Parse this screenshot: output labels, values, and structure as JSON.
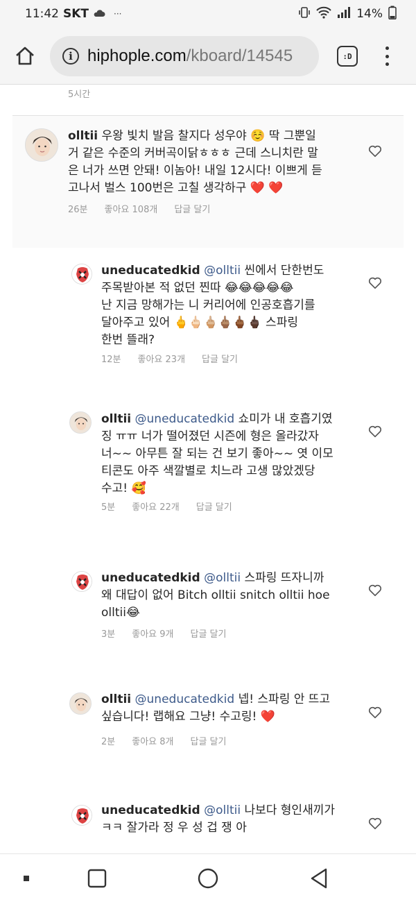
{
  "status_bar": {
    "time": "11:42",
    "carrier": "SKT",
    "extra": "···",
    "battery": "14%"
  },
  "browser": {
    "url_domain": "hiphople.com",
    "url_path": "/kboard/14545",
    "tab_label": ":D"
  },
  "thread": {
    "top_time": "5시간",
    "comments": [
      {
        "user": "olltii",
        "mention": "",
        "lines": [
          "우왕 빛치 발음 찰지다 성우야 ☺️ 딱 그뿐일",
          "거 같은 수준의 커버곡이닭ㅎㅎㅎ 근데 스니치란 말",
          "은 너가 쓰면 안돼! 이놈아! 내일 12시다! 이쁘게 듣",
          "고나서 벌스 100번은 고칠 생각하구 ❤️ ❤️"
        ],
        "time": "26분",
        "likes": "좋아요 108개",
        "reply": "답글 달기"
      },
      {
        "user": "uneducatedkid",
        "mention": "@olltii",
        "lines": [
          "씬에서 단한번도",
          "주목받아본 적 없던 찐따 😂😂😂😂😂",
          "난 지금 망해가는 니 커리어에 인공호흡기를",
          "달아주고 있어 🖕🖕🏻🖕🏼🖕🏽🖕🏾🖕🏿 스파링",
          "한번 뜰래?"
        ],
        "time": "12분",
        "likes": "좋아요 23개",
        "reply": "답글 달기"
      },
      {
        "user": "olltii",
        "mention": "@uneducatedkid",
        "lines": [
          "쇼미가 내 호흡기였",
          "징 ㅠㅠ 너가 떨어졌던 시즌에 형은 올라갔자",
          "너~~ 아무튼 잘 되는 건 보기 좋아~~ 엿 이모",
          "티콘도 아주 색깔별로 치느라 고생 많았겠당",
          "수고! 🥰"
        ],
        "time": "5분",
        "likes": "좋아요 22개",
        "reply": "답글 달기"
      },
      {
        "user": "uneducatedkid",
        "mention": "@olltii",
        "lines": [
          "스파링 뜨자니까",
          "왜 대답이 없어 Bitch olltii snitch olltii hoe",
          "olltii😂"
        ],
        "time": "3분",
        "likes": "좋아요 9개",
        "reply": "답글 달기"
      },
      {
        "user": "olltii",
        "mention": "@uneducatedkid",
        "lines": [
          "넵! 스파링 안 뜨고",
          "싶습니다! 랩해요 그냥! 수고링! ❤️"
        ],
        "time": "2분",
        "likes": "좋아요 8개",
        "reply": "답글 달기"
      },
      {
        "user": "uneducatedkid",
        "mention": "@olltii",
        "lines": [
          "나보다 형인새끼가",
          "ㅋㅋ 잘가라 정 우 성 겁 쟁 아"
        ],
        "time": "",
        "likes": "",
        "reply": ""
      }
    ]
  }
}
